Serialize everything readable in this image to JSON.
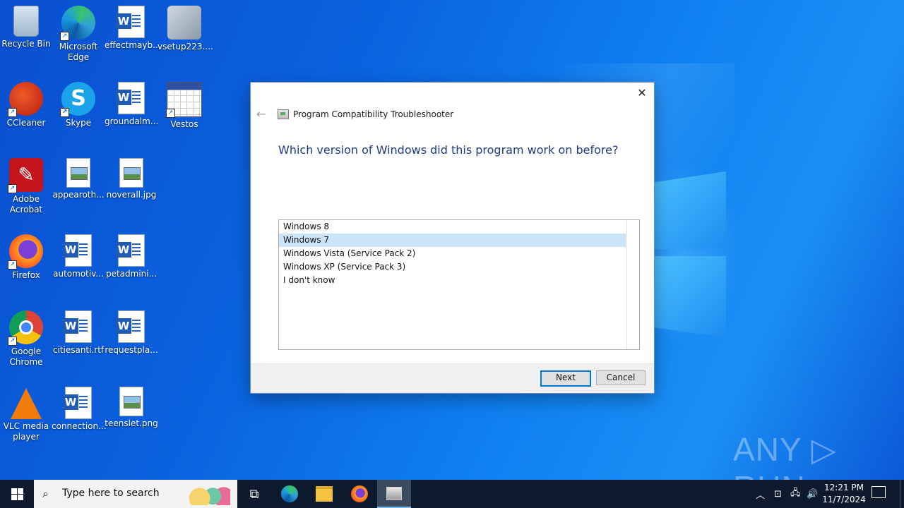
{
  "desktop": {
    "icons": [
      {
        "label": "Recycle Bin"
      },
      {
        "label": "Microsoft Edge"
      },
      {
        "label": "effectmayb..."
      },
      {
        "label": "vsetup223...."
      },
      {
        "label": "CCleaner"
      },
      {
        "label": "Skype"
      },
      {
        "label": "groundalm..."
      },
      {
        "label": "Vestos"
      },
      {
        "label": "Adobe Acrobat"
      },
      {
        "label": "appearoth..."
      },
      {
        "label": "noverall.jpg"
      },
      {
        "label": "Firefox"
      },
      {
        "label": "automotiv..."
      },
      {
        "label": "petadmini..."
      },
      {
        "label": "Google Chrome"
      },
      {
        "label": "citiesanti.rtf"
      },
      {
        "label": "requestpla..."
      },
      {
        "label": "VLC media player"
      },
      {
        "label": "connection..."
      },
      {
        "label": "teenslet.png"
      }
    ],
    "watermark": "ANY ▷ RUN"
  },
  "dialog": {
    "title": "Program Compatibility Troubleshooter",
    "heading": "Which version of Windows did this program work on before?",
    "options": [
      {
        "label": "Windows 8",
        "selected": false
      },
      {
        "label": "Windows 7",
        "selected": true
      },
      {
        "label": "Windows Vista (Service Pack 2)",
        "selected": false
      },
      {
        "label": "Windows XP (Service Pack 3)",
        "selected": false
      },
      {
        "label": "I don't know",
        "selected": false
      }
    ],
    "next_label": "Next",
    "cancel_label": "Cancel",
    "close_glyph": "✕",
    "back_glyph": "←"
  },
  "taskbar": {
    "search_placeholder": "Type here to search",
    "time": "12:21 PM",
    "date": "11/7/2024"
  },
  "colors": {
    "accent": "#0078d7",
    "heading": "#1c3a87",
    "selection": "#cce4f7"
  }
}
